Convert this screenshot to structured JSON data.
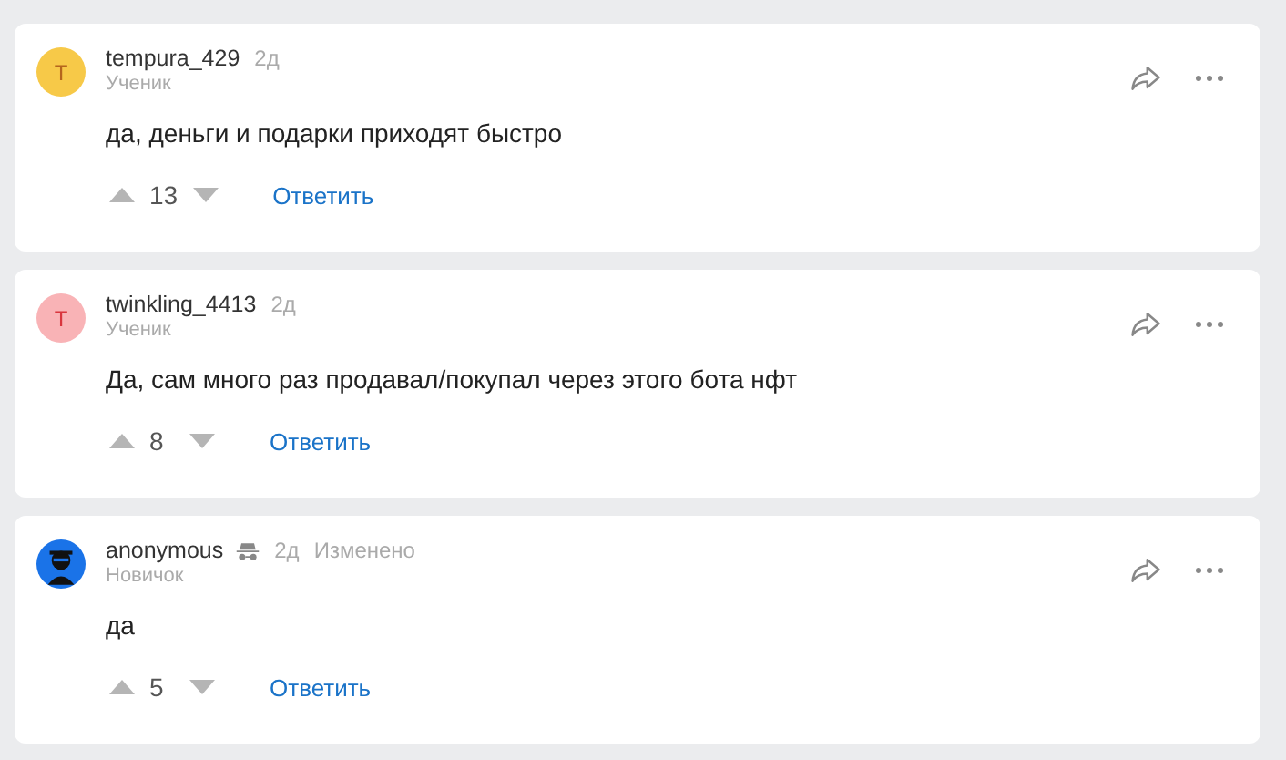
{
  "comments": [
    {
      "avatar": {
        "kind": "letter",
        "letter": "T",
        "color": "#f7c948"
      },
      "author": "tempura_429",
      "incognito": false,
      "time": "2д",
      "rank": "Ученик",
      "text": "да, деньги и подарки приходят быстро",
      "votes": "13",
      "reply": "Ответить"
    },
    {
      "avatar": {
        "kind": "letter",
        "letter": "T",
        "color": "#f9b3b6"
      },
      "author": "twinkling_4413",
      "incognito": false,
      "time": "2д",
      "rank": "Ученик",
      "text": "Да, сам много раз продавал/покупал через этого бота нфт",
      "votes": "8",
      "reply": "Ответить"
    },
    {
      "avatar": {
        "kind": "anonymous"
      },
      "author": "anonymous",
      "incognito": true,
      "time": "2д",
      "edited": "Изменено",
      "rank": "Новичок",
      "text": "да",
      "votes": "5",
      "reply": "Ответить"
    }
  ]
}
